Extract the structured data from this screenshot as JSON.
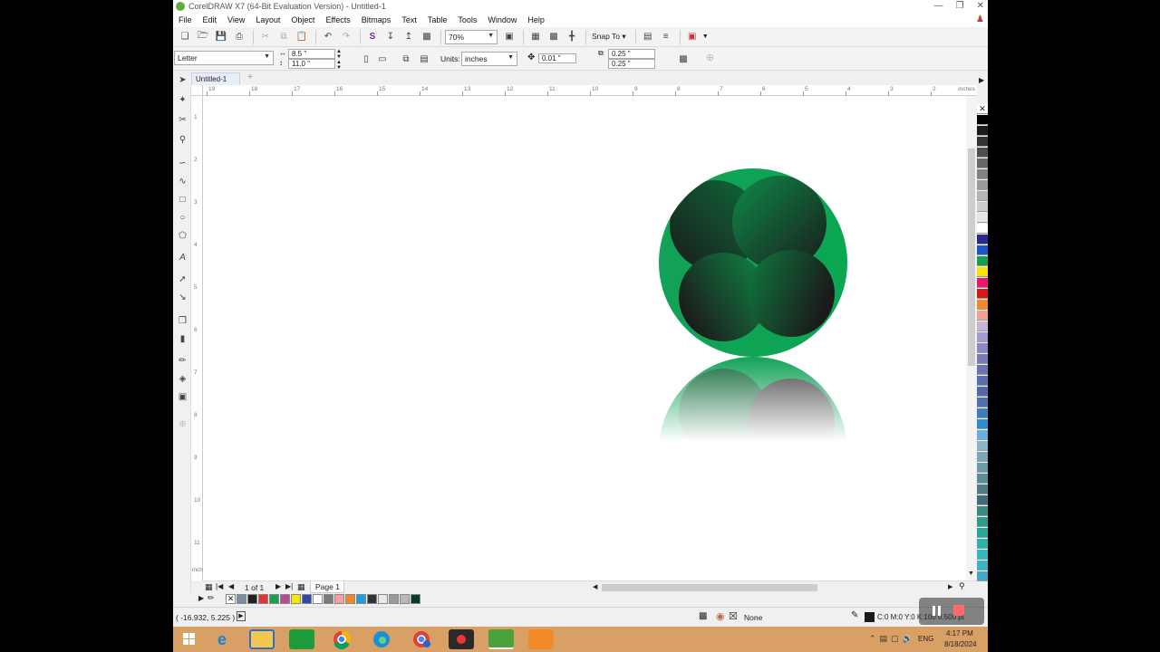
{
  "window": {
    "title": "CorelDRAW X7 (64-Bit Evaluation Version) - Untitled-1"
  },
  "menu": [
    "File",
    "Edit",
    "View",
    "Layout",
    "Object",
    "Effects",
    "Bitmaps",
    "Text",
    "Table",
    "Tools",
    "Window",
    "Help"
  ],
  "standard_toolbar": {
    "zoom": "70%",
    "snap_to": "Snap To"
  },
  "property_bar": {
    "paper_size": "Letter",
    "width": "8.5 \"",
    "height": "11.0 \"",
    "units_label": "Units:",
    "units": "inches",
    "nudge": "0.01 \"",
    "duplicate_x": "0.25 \"",
    "duplicate_y": "0.25 \""
  },
  "document_tab": "Untitled-1",
  "ruler": {
    "h_labels": [
      "19",
      "18",
      "17",
      "16",
      "15",
      "14",
      "13",
      "12",
      "11",
      "10",
      "9",
      "8",
      "7",
      "6",
      "5",
      "4",
      "3",
      "2"
    ],
    "h_units": "inches",
    "v_labels": [
      "1",
      "2",
      "3",
      "4",
      "5",
      "6",
      "7",
      "8",
      "9",
      "10",
      "11"
    ],
    "v_units": "inches"
  },
  "page_nav": {
    "count": "1 of 1",
    "page_tab": "Page 1"
  },
  "status": {
    "cursor": "( -16.932, 5.225 )",
    "fill_none": "None",
    "outline": "C:0 M:0 Y:0 K:100  0.500 pt"
  },
  "taskbar": {
    "language": "ENG",
    "time": "4:17 PM",
    "date": "8/18/2024"
  },
  "colors": {
    "green_light": "#11a85a",
    "green_dark": "#0a3d24",
    "dark": "#1b1b1b"
  }
}
